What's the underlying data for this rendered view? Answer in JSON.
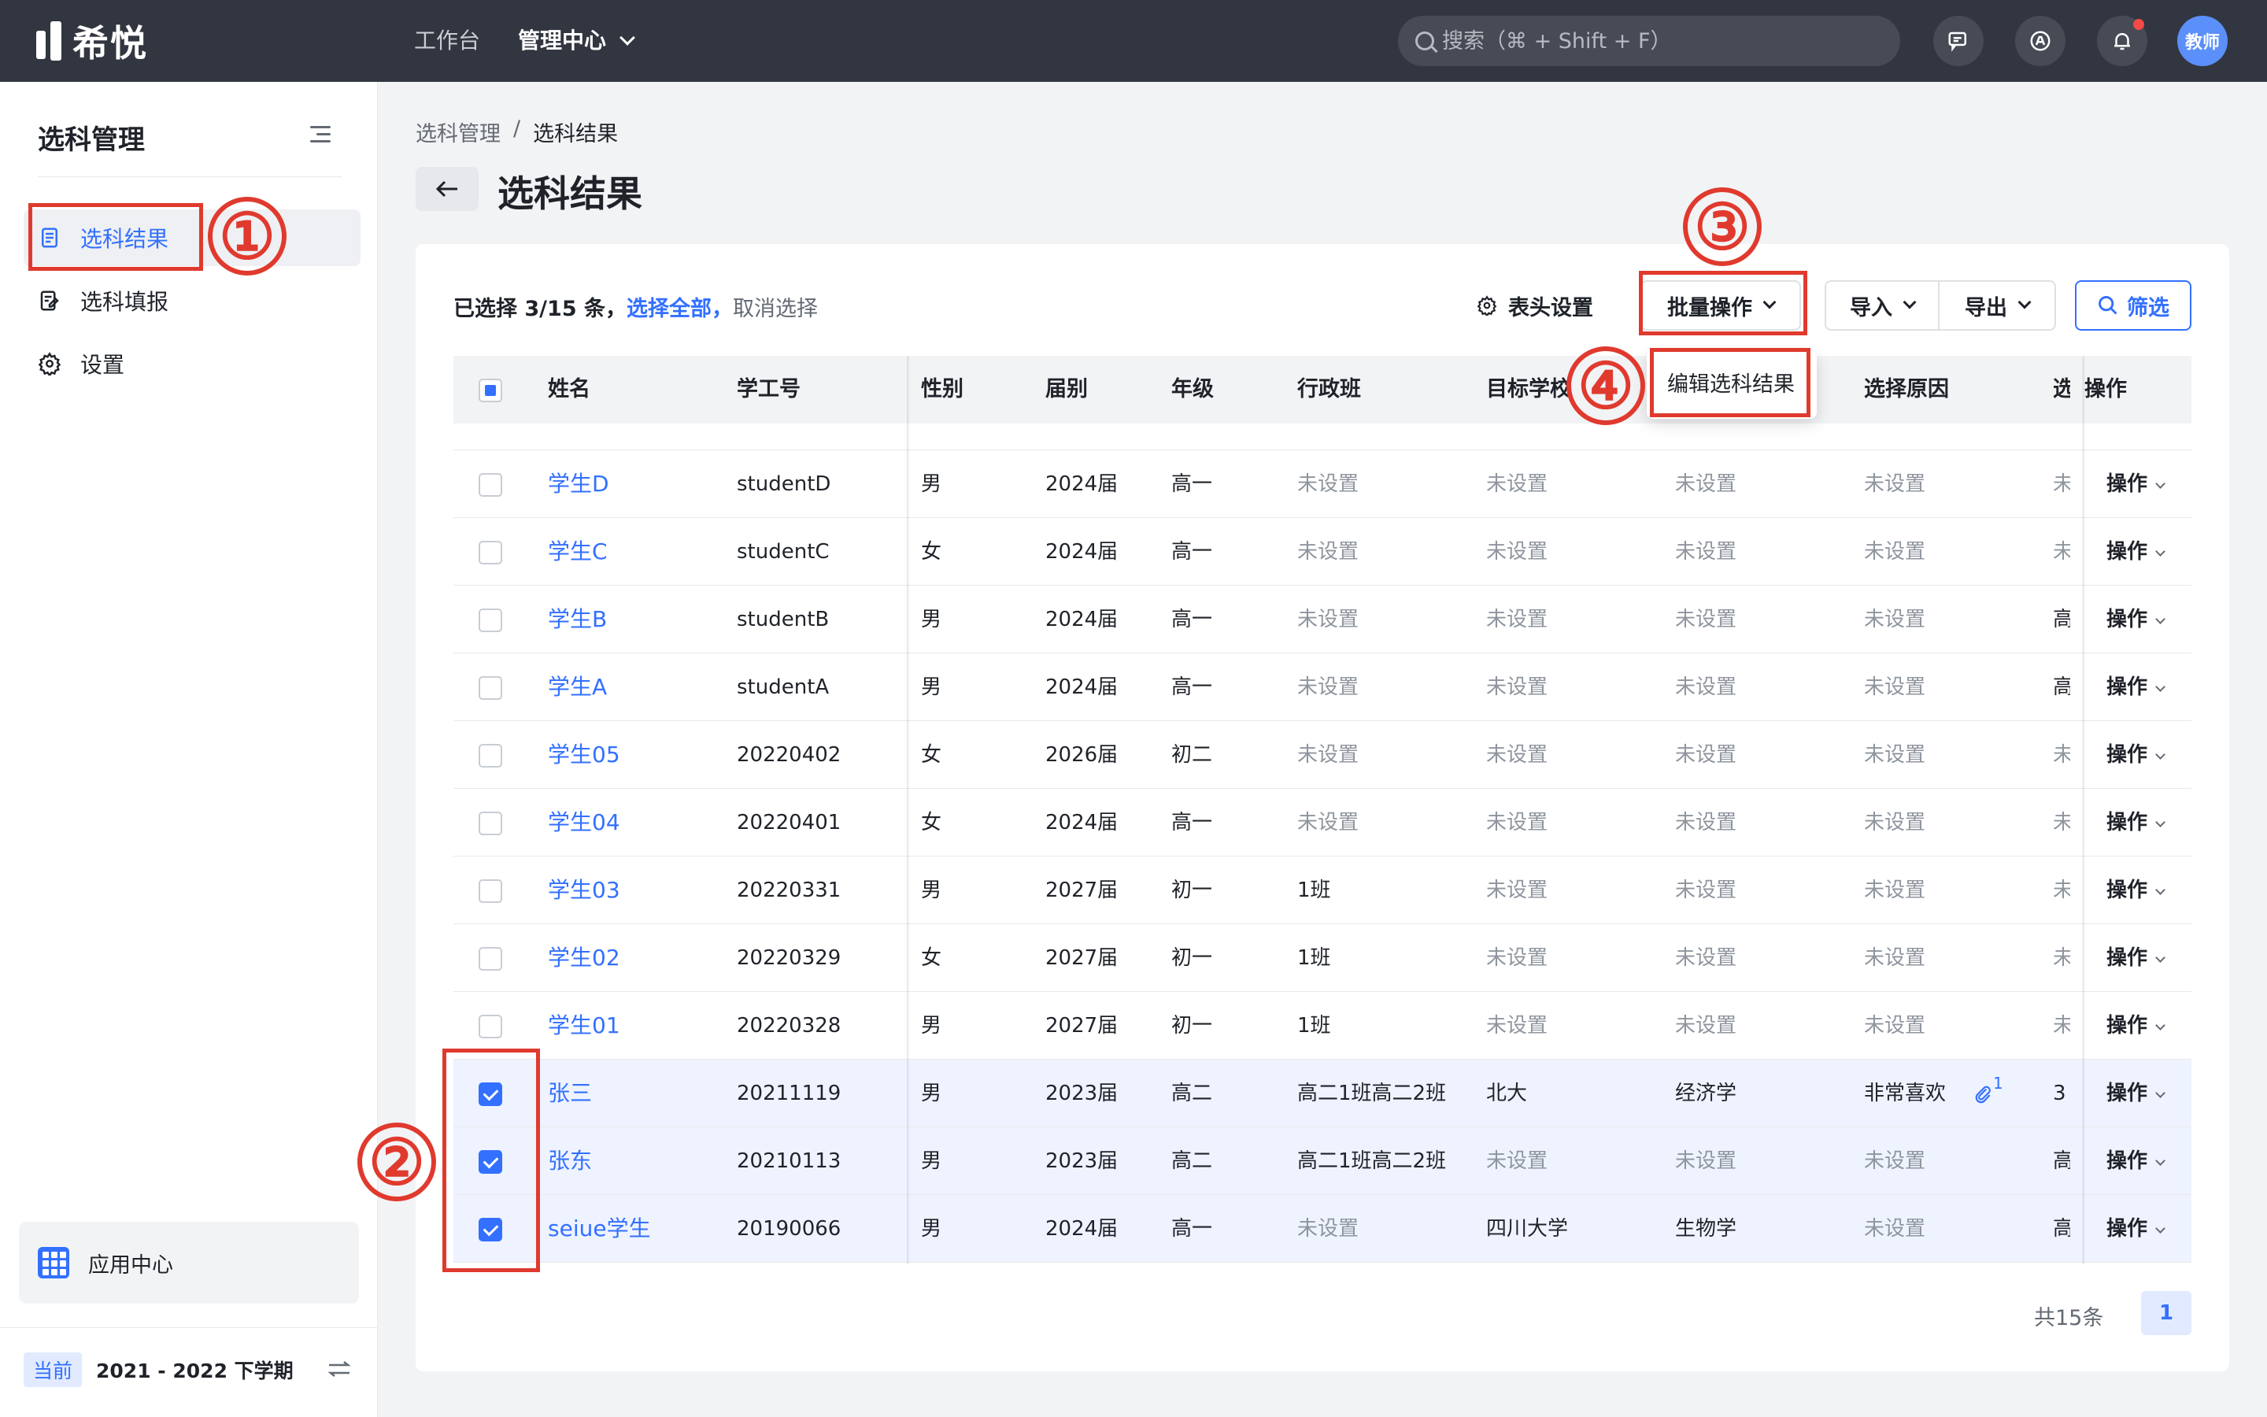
{
  "app": {
    "name": "希悦"
  },
  "topnav": {
    "workbench": "工作台",
    "management": "管理中心",
    "search_placeholder": "搜索（⌘ + Shift + F）",
    "avatar_text": "教师"
  },
  "sidebar": {
    "title": "选科管理",
    "items": [
      {
        "label": "选科结果",
        "icon": "document-icon",
        "active": true
      },
      {
        "label": "选科填报",
        "icon": "edit-form-icon"
      },
      {
        "label": "设置",
        "icon": "gear-icon"
      }
    ],
    "app_center": "应用中心",
    "term_badge": "当前",
    "term": "2021 - 2022 下学期"
  },
  "breadcrumb": [
    "选科管理",
    "选科结果"
  ],
  "breadcrumb_sep": "/",
  "page_title": "选科结果",
  "toolbar": {
    "selected_info": "已选择 3/15 条，",
    "select_all": "选择全部，",
    "cancel_select": "取消选择",
    "header_settings": "表头设置",
    "batch_ops": "批量操作",
    "import": "导入",
    "export": "导出",
    "filter": "筛选"
  },
  "dropdown": {
    "item": "编辑选科结果"
  },
  "table": {
    "columns": [
      "姓名",
      "学工号",
      "性别",
      "届别",
      "年级",
      "行政班",
      "目标学校",
      "选择原因",
      "选",
      "操作"
    ],
    "rows": [
      {
        "name": "学生D",
        "id": "studentD",
        "gender": "男",
        "cohort": "2024届",
        "grade": "高一",
        "class": "未设置",
        "school": "未设置",
        "major": "未设置",
        "reason": "未设置",
        "extra": "未",
        "op": "操作",
        "checked": false
      },
      {
        "name": "学生C",
        "id": "studentC",
        "gender": "女",
        "cohort": "2024届",
        "grade": "高一",
        "class": "未设置",
        "school": "未设置",
        "major": "未设置",
        "reason": "未设置",
        "extra": "未",
        "op": "操作",
        "checked": false
      },
      {
        "name": "学生B",
        "id": "studentB",
        "gender": "男",
        "cohort": "2024届",
        "grade": "高一",
        "class": "未设置",
        "school": "未设置",
        "major": "未设置",
        "reason": "未设置",
        "extra": "高",
        "op": "操作",
        "checked": false
      },
      {
        "name": "学生A",
        "id": "studentA",
        "gender": "男",
        "cohort": "2024届",
        "grade": "高一",
        "class": "未设置",
        "school": "未设置",
        "major": "未设置",
        "reason": "未设置",
        "extra": "高",
        "op": "操作",
        "checked": false
      },
      {
        "name": "学生05",
        "id": "20220402",
        "gender": "女",
        "cohort": "2026届",
        "grade": "初二",
        "class": "未设置",
        "school": "未设置",
        "major": "未设置",
        "reason": "未设置",
        "extra": "未",
        "op": "操作",
        "checked": false
      },
      {
        "name": "学生04",
        "id": "20220401",
        "gender": "女",
        "cohort": "2024届",
        "grade": "高一",
        "class": "未设置",
        "school": "未设置",
        "major": "未设置",
        "reason": "未设置",
        "extra": "未",
        "op": "操作",
        "checked": false
      },
      {
        "name": "学生03",
        "id": "20220331",
        "gender": "男",
        "cohort": "2027届",
        "grade": "初一",
        "class": "1班",
        "school": "未设置",
        "major": "未设置",
        "reason": "未设置",
        "extra": "未",
        "op": "操作",
        "checked": false
      },
      {
        "name": "学生02",
        "id": "20220329",
        "gender": "女",
        "cohort": "2027届",
        "grade": "初一",
        "class": "1班",
        "school": "未设置",
        "major": "未设置",
        "reason": "未设置",
        "extra": "未",
        "op": "操作",
        "checked": false
      },
      {
        "name": "学生01",
        "id": "20220328",
        "gender": "男",
        "cohort": "2027届",
        "grade": "初一",
        "class": "1班",
        "school": "未设置",
        "major": "未设置",
        "reason": "未设置",
        "extra": "未",
        "op": "操作",
        "checked": false
      },
      {
        "name": "张三",
        "id": "20211119",
        "gender": "男",
        "cohort": "2023届",
        "grade": "高二",
        "class": "高二1班高二2班",
        "school": "北大",
        "major": "经济学",
        "reason": "非常喜欢",
        "attachments": "1",
        "extra": "3",
        "op": "操作",
        "checked": true
      },
      {
        "name": "张东",
        "id": "20210113",
        "gender": "男",
        "cohort": "2023届",
        "grade": "高二",
        "class": "高二1班高二2班",
        "school": "未设置",
        "major": "未设置",
        "reason": "未设置",
        "extra": "高",
        "op": "操作",
        "checked": true
      },
      {
        "name": "seiue学生",
        "id": "20190066",
        "gender": "男",
        "cohort": "2024届",
        "grade": "高一",
        "class": "未设置",
        "school": "四川大学",
        "major": "生物学",
        "reason": "未设置",
        "extra": "高",
        "op": "操作",
        "checked": true
      }
    ]
  },
  "pagination": {
    "total": "共15条",
    "page": "1"
  },
  "annotations": [
    "①",
    "②",
    "③",
    "④"
  ],
  "colors": {
    "accent": "#3370ff",
    "annotation": "#e03a2e",
    "topbar": "#323640"
  }
}
